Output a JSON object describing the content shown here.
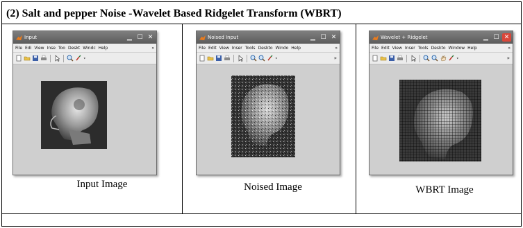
{
  "heading": "(2) Salt and pepper Noise  -Wavelet Based Ridgelet Transform  (WBRT)",
  "windows": [
    {
      "title": "Input",
      "menu": [
        "File",
        "Edi",
        "View",
        "Inse",
        "Too",
        "Deskt",
        "Windc",
        "Help"
      ],
      "caption": "Input Image"
    },
    {
      "title": "Noised Input",
      "menu": [
        "File",
        "Edit",
        "View",
        "Inser",
        "Tools",
        "Deskto",
        "Windo",
        "Help"
      ],
      "caption": "Noised Image"
    },
    {
      "title": "Wavelet + Ridgelet",
      "menu": [
        "File",
        "Edit",
        "View",
        "Inser",
        "Tools",
        "Deskto",
        "Window",
        "Help"
      ],
      "caption": "WBRT Image"
    }
  ],
  "glyphs": {
    "minimize": "▁",
    "maximize": "☐",
    "close": "✕",
    "menu_more": "»",
    "toolbar_more": "»"
  },
  "colors": {
    "titlebar": "#6e6e6e",
    "close_button_active": "#d9473a",
    "figure_background": "#cfcfcf"
  }
}
